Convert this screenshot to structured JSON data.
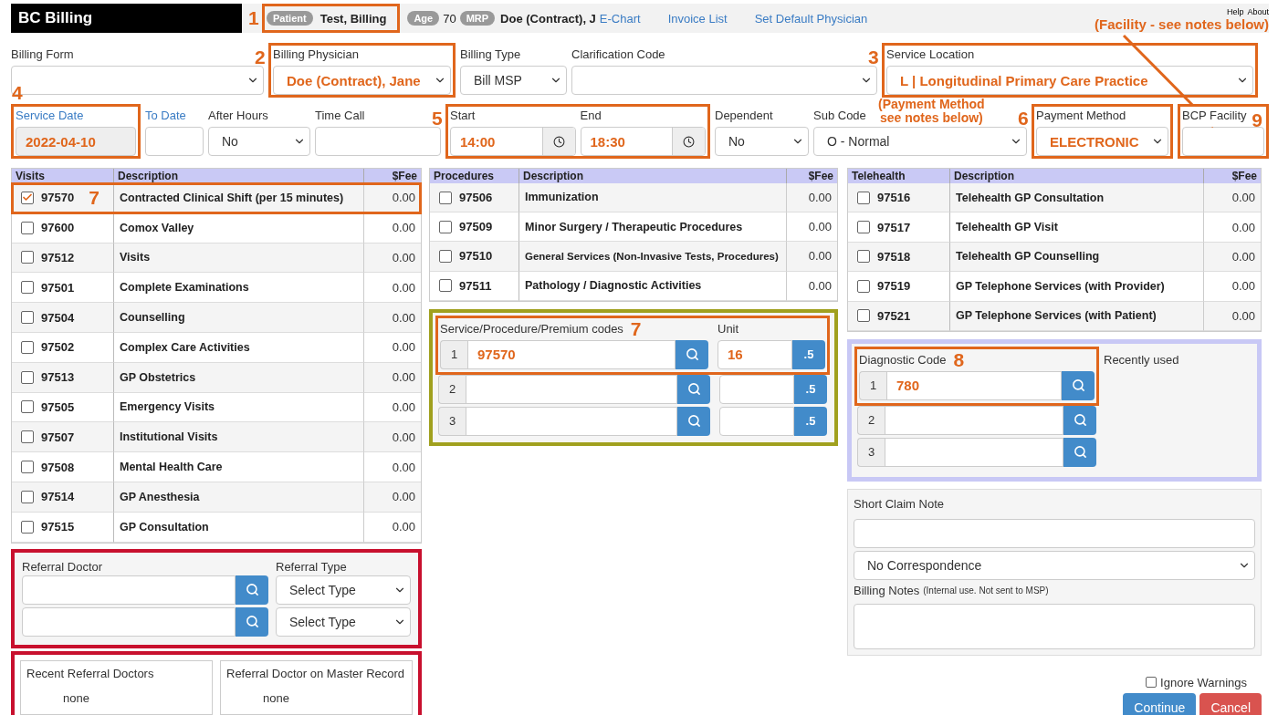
{
  "header": {
    "title": "BC Billing",
    "patient": {
      "callout": "1",
      "tag": "Patient",
      "name": "Test, Billing"
    },
    "age": {
      "tag": "Age",
      "value": "70"
    },
    "mrp": {
      "tag": "MRP",
      "value": "Doe (Contract), J"
    },
    "links": [
      "E-Chart",
      "Invoice List",
      "Set Default Physician"
    ],
    "help": "Help",
    "about": "About"
  },
  "annotations": {
    "facility_note": "(Facility - see notes below)",
    "payment_note": "(Payment Method\nsee notes below)"
  },
  "form_rows": [
    [
      {
        "fields": [
          {
            "label": "Billing Form",
            "label_link": false,
            "kind": "select"
          }
        ]
      },
      {
        "callout": "2",
        "fields": [
          {
            "label": "Billing Physician",
            "label_link": false,
            "kind": "select",
            "value": "Doe (Contract), Jane"
          }
        ]
      },
      {
        "fields": [
          {
            "label": "Billing Type",
            "label_link": false,
            "kind": "select",
            "value": "Bill MSP"
          }
        ]
      },
      {
        "fields": [
          {
            "label": "Clarification Code",
            "label_link": false,
            "kind": "select"
          }
        ]
      },
      {
        "callout": "3",
        "fields": [
          {
            "label": "Service Location",
            "label_link": false,
            "kind": "select",
            "value": "L | Longitudinal Primary Care Practice"
          }
        ]
      }
    ],
    [
      {
        "callout": "4",
        "fields": [
          {
            "label": "Service Date",
            "label_link": true,
            "kind": "readonly",
            "value": "2022-04-10"
          }
        ]
      },
      {
        "fields": [
          {
            "label": "To Date",
            "label_link": true,
            "kind": "input"
          }
        ]
      },
      {
        "fields": [
          {
            "label": "After Hours",
            "label_link": false,
            "kind": "select",
            "value": "No"
          }
        ]
      },
      {
        "fields": [
          {
            "label": "Time Call",
            "label_link": false,
            "kind": "input"
          }
        ]
      },
      {
        "callout": "5",
        "fields": [
          {
            "label": "Start",
            "label_link": false,
            "kind": "time",
            "value": "14:00"
          },
          {
            "label": "End",
            "label_link": false,
            "kind": "time",
            "value": "18:30"
          }
        ]
      },
      {
        "fields": [
          {
            "label": "Dependent",
            "label_link": false,
            "kind": "select",
            "value": "No"
          }
        ]
      },
      {
        "fields": [
          {
            "label": "Sub Code",
            "label_link": false,
            "kind": "select",
            "value": "O - Normal"
          }
        ]
      },
      {
        "callout": "6",
        "fields": [
          {
            "label": "Payment Method",
            "label_link": false,
            "kind": "select",
            "value": "ELECTRONIC"
          }
        ]
      },
      {
        "callout": "9",
        "fields": [
          {
            "label": "BCP Facility",
            "label_link": false,
            "kind": "input"
          }
        ]
      }
    ]
  ],
  "tables": [
    {
      "columns": [
        "Visits",
        "Description",
        "$Fee"
      ],
      "rows": [
        {
          "checked": true,
          "code": "97570",
          "description": "Contracted Clinical Shift (per 15 minutes)",
          "fee": "0.00",
          "callout": "7"
        },
        {
          "checked": false,
          "code": "97600",
          "description": "Comox Valley",
          "fee": "0.00"
        },
        {
          "checked": false,
          "code": "97512",
          "description": "Visits",
          "fee": "0.00"
        },
        {
          "checked": false,
          "code": "97501",
          "description": "Complete Examinations",
          "fee": "0.00"
        },
        {
          "checked": false,
          "code": "97504",
          "description": "Counselling",
          "fee": "0.00"
        },
        {
          "checked": false,
          "code": "97502",
          "description": "Complex Care Activities",
          "fee": "0.00"
        },
        {
          "checked": false,
          "code": "97513",
          "description": "GP Obstetrics",
          "fee": "0.00"
        },
        {
          "checked": false,
          "code": "97505",
          "description": "Emergency Visits",
          "fee": "0.00"
        },
        {
          "checked": false,
          "code": "97507",
          "description": "Institutional Visits",
          "fee": "0.00"
        },
        {
          "checked": false,
          "code": "97508",
          "description": "Mental Health Care",
          "fee": "0.00"
        },
        {
          "checked": false,
          "code": "97514",
          "description": "GP Anesthesia",
          "fee": "0.00"
        },
        {
          "checked": false,
          "code": "97515",
          "description": "GP Consultation",
          "fee": "0.00"
        }
      ]
    },
    {
      "columns": [
        "Procedures",
        "Description",
        "$Fee"
      ],
      "rows": [
        {
          "checked": false,
          "code": "97506",
          "description": "Immunization",
          "fee": "0.00"
        },
        {
          "checked": false,
          "code": "97509",
          "description": "Minor Surgery / Therapeutic Procedures",
          "fee": "0.00"
        },
        {
          "checked": false,
          "code": "97510",
          "description": "General Services (Non-Invasive Tests, Procedures)",
          "fee": "0.00"
        },
        {
          "checked": false,
          "code": "97511",
          "description": "Pathology / Diagnostic Activities",
          "fee": "0.00"
        }
      ]
    },
    {
      "columns": [
        "Telehealth",
        "Description",
        "$Fee"
      ],
      "rows": [
        {
          "checked": false,
          "code": "97516",
          "description": "Telehealth GP Consultation",
          "fee": "0.00"
        },
        {
          "checked": false,
          "code": "97517",
          "description": "Telehealth GP Visit",
          "fee": "0.00"
        },
        {
          "checked": false,
          "code": "97518",
          "description": "Telehealth GP Counselling",
          "fee": "0.00"
        },
        {
          "checked": false,
          "code": "97519",
          "description": "GP Telephone Services (with Provider)",
          "fee": "0.00"
        },
        {
          "checked": false,
          "code": "97521",
          "description": "GP Telephone Services (with Patient)",
          "fee": "0.00"
        }
      ]
    }
  ],
  "service_codes": {
    "label": "Service/Procedure/Premium codes",
    "callout": "7",
    "unit_label": "Unit",
    "rows": [
      {
        "index": "1",
        "code": "97570",
        "unit": "16",
        "unit_button": ".5"
      },
      {
        "index": "2",
        "unit_button": ".5"
      },
      {
        "index": "3",
        "unit_button": ".5"
      }
    ]
  },
  "diagnostic_codes": {
    "label": "Diagnostic Code",
    "callout": "8",
    "recent_label": "Recently used",
    "rows": [
      {
        "index": "1",
        "code": "780"
      },
      {
        "index": "2"
      },
      {
        "index": "3"
      }
    ]
  },
  "referral": {
    "doctor_label": "Referral Doctor",
    "type_label": "Referral Type",
    "rows": [
      {
        "type": "Select Type"
      },
      {
        "type": "Select Type"
      }
    ],
    "recent": {
      "title": "Recent Referral Doctors",
      "value": "none"
    },
    "master": {
      "title": "Referral Doctor on Master Record",
      "value": "none"
    }
  },
  "notes": {
    "short_claim_label": "Short Claim Note",
    "correspondence": "No Correspondence",
    "billing_notes_label": "Billing Notes",
    "billing_notes_hint": "(Internal use. Not sent to MSP)"
  },
  "ignore_warnings": {
    "label": "Ignore Warnings",
    "checked": false
  },
  "buttons": [
    {
      "label": "Continue",
      "kind": "primary"
    },
    {
      "label": "Cancel",
      "kind": "danger"
    }
  ]
}
